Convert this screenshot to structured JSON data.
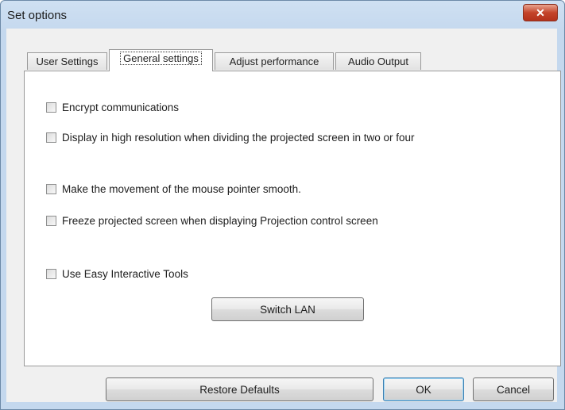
{
  "window": {
    "title": "Set options",
    "close_label": "✕"
  },
  "tabs": [
    {
      "label": "User Settings"
    },
    {
      "label": "General settings"
    },
    {
      "label": "Adjust performance"
    },
    {
      "label": "Audio Output"
    }
  ],
  "active_tab": "General settings",
  "options": [
    {
      "label": "Encrypt communications",
      "checked": false
    },
    {
      "label": "Display in high resolution when dividing the projected screen in two or four",
      "checked": false
    },
    {
      "label": "Make the movement of the mouse pointer smooth.",
      "checked": false
    },
    {
      "label": "Freeze projected screen when displaying Projection control screen",
      "checked": false
    },
    {
      "label": "Use Easy Interactive Tools",
      "checked": false
    }
  ],
  "buttons": {
    "switch_lan": "Switch LAN",
    "restore_defaults": "Restore Defaults",
    "ok": "OK",
    "cancel": "Cancel"
  }
}
